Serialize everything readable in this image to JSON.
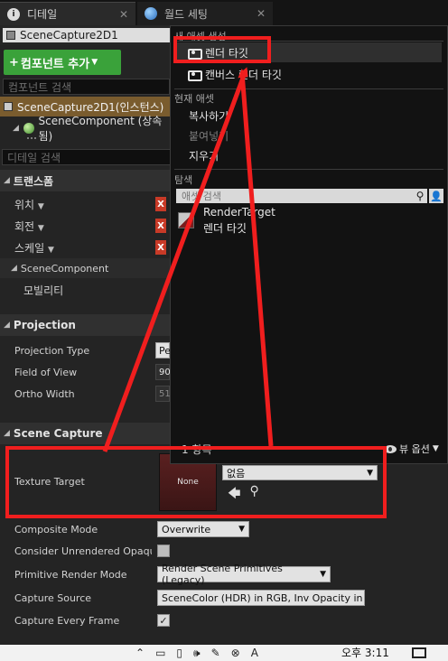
{
  "tabs": [
    {
      "label": "디테일",
      "icon": "info-icon",
      "close": "✕"
    },
    {
      "label": "월드 세팅",
      "icon": "globe-icon",
      "close": "✕"
    }
  ],
  "actor": {
    "name": "SceneCapture2D1"
  },
  "components": {
    "add_label": "컴포넌트 추가",
    "search_placeholder": "컴포넌트 검색",
    "instance_label": "SceneCapture2D1(인스턴스)",
    "scene_component": "SceneComponent (상속됨)"
  },
  "details": {
    "search_placeholder": "디테일 검색",
    "transform": {
      "title": "트랜스폼",
      "location": "위치",
      "rotation": "회전",
      "scale": "스케일"
    },
    "scene_component": {
      "title": "SceneComponent",
      "mobility": "모빌리티"
    },
    "projection": {
      "title": "Projection",
      "projection_type_label": "Projection Type",
      "projection_type_value": "Pe",
      "fov_label": "Field of View",
      "fov_value": "90",
      "ortho_label": "Ortho Width",
      "ortho_value": "51"
    },
    "scene_capture": {
      "title": "Scene Capture",
      "texture_target_label": "Texture Target",
      "texture_thumb": "None",
      "texture_value": "없음",
      "composite_mode_label": "Composite Mode",
      "composite_mode_value": "Overwrite",
      "consider_unrendered_label": "Consider Unrendered Opaque P",
      "primitive_render_label": "Primitive Render Mode",
      "primitive_render_value": "Render Scene Primitives (Legacy)",
      "capture_source_label": "Capture Source",
      "capture_source_value": "SceneColor (HDR) in RGB, Inv Opacity in A",
      "capture_every_frame_label": "Capture Every Frame"
    }
  },
  "popup": {
    "new_asset_header": "새 애셋 생성",
    "new_items": [
      "렌더 타깃",
      "캔버스 렌더 타깃"
    ],
    "current_asset_header": "현재 애셋",
    "current_items": [
      "복사하기",
      "붙여넣기",
      "지우기"
    ],
    "browse_header": "탐색",
    "asset_search_placeholder": "애셋 검색",
    "asset": {
      "type": "RenderTarget",
      "name": "렌더 타깃"
    },
    "count": "1 항목",
    "view_options": "뷰 옵션"
  },
  "colors": {
    "annotation_red": "#f01e1e",
    "add_button_green": "#3aa23a",
    "selected_row": "#7a5c2e"
  },
  "taskbar": {
    "time": "오후 3:11"
  }
}
